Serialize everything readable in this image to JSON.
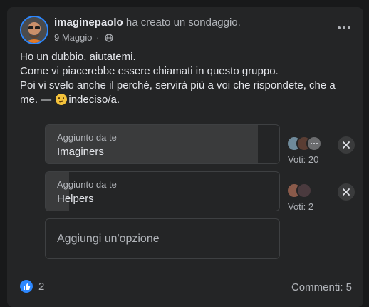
{
  "post": {
    "author": "imaginepaolo",
    "action": "ha creato un sondaggio.",
    "date": "9 Maggio",
    "separator": "·",
    "lines": [
      "Ho un dubbio, aiutatemi.",
      "Come vi piacerebbe essere chiamati in questo gruppo.",
      "Poi vi svelo anche il perché, servirà più a voi che rispondete, che a",
      "me. —",
      "indeciso/a."
    ],
    "emoji_icon": "confused-face-icon"
  },
  "poll": {
    "options": [
      {
        "added_by": "Aggiunto da te",
        "label": "Imaginers",
        "votes_text": "Voti: 20",
        "vote_share": 0.91
      },
      {
        "added_by": "Aggiunto da te",
        "label": "Helpers",
        "votes_text": "Voti: 2",
        "vote_share": 0.1
      }
    ],
    "add_option": "Aggiungi un'opzione"
  },
  "footer": {
    "like_count": "2",
    "comments": "Commenti: 5"
  },
  "colors": {
    "background": "#18191a",
    "card": "#242526",
    "accent": "#2d88ff",
    "text": "#e4e6eb",
    "secondary_text": "#b0b3b8"
  }
}
